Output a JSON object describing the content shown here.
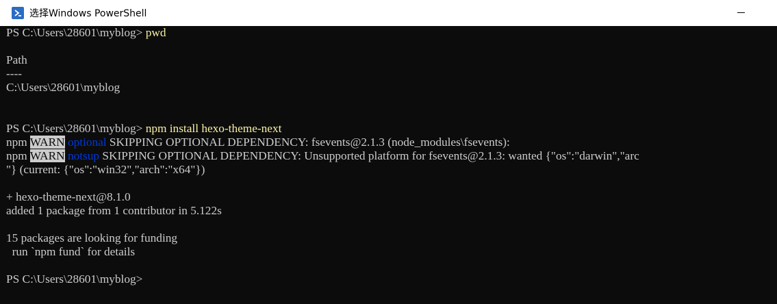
{
  "window": {
    "title": "选择Windows PowerShell",
    "icon": "powershell-icon",
    "minimize_label": "minimize"
  },
  "terminal": {
    "prompt": "PS C:\\Users\\28601\\myblog>",
    "cmd1": " pwd",
    "path_header": "Path",
    "path_rule": "----",
    "path_value": "C:\\Users\\28601\\myblog",
    "cmd2": " npm install hexo-theme-next",
    "warn1": {
      "prefix": "npm ",
      "level": "WARN",
      "code": " optional",
      "message": " SKIPPING OPTIONAL DEPENDENCY: fsevents@2.1.3 (node_modules\\fsevents):"
    },
    "warn2": {
      "prefix": "npm ",
      "level": "WARN",
      "code": " notsup",
      "message": " SKIPPING OPTIONAL DEPENDENCY: Unsupported platform for fsevents@2.1.3: wanted {\"os\":\"darwin\",\"arc",
      "continuation": "\"} (current: {\"os\":\"win32\",\"arch\":\"x64\"})"
    },
    "install_result": "+ hexo-theme-next@8.1.0",
    "added_line": "added 1 package from 1 contributor in 5.122s",
    "funding_line": "15 packages are looking for funding",
    "fund_hint": "  run `npm fund` for details",
    "colors": {
      "background": "#0c0c0c",
      "text": "#cccccc",
      "command": "#f9f1a5",
      "warn_bg": "#cccccc",
      "code": "#0037da"
    }
  }
}
